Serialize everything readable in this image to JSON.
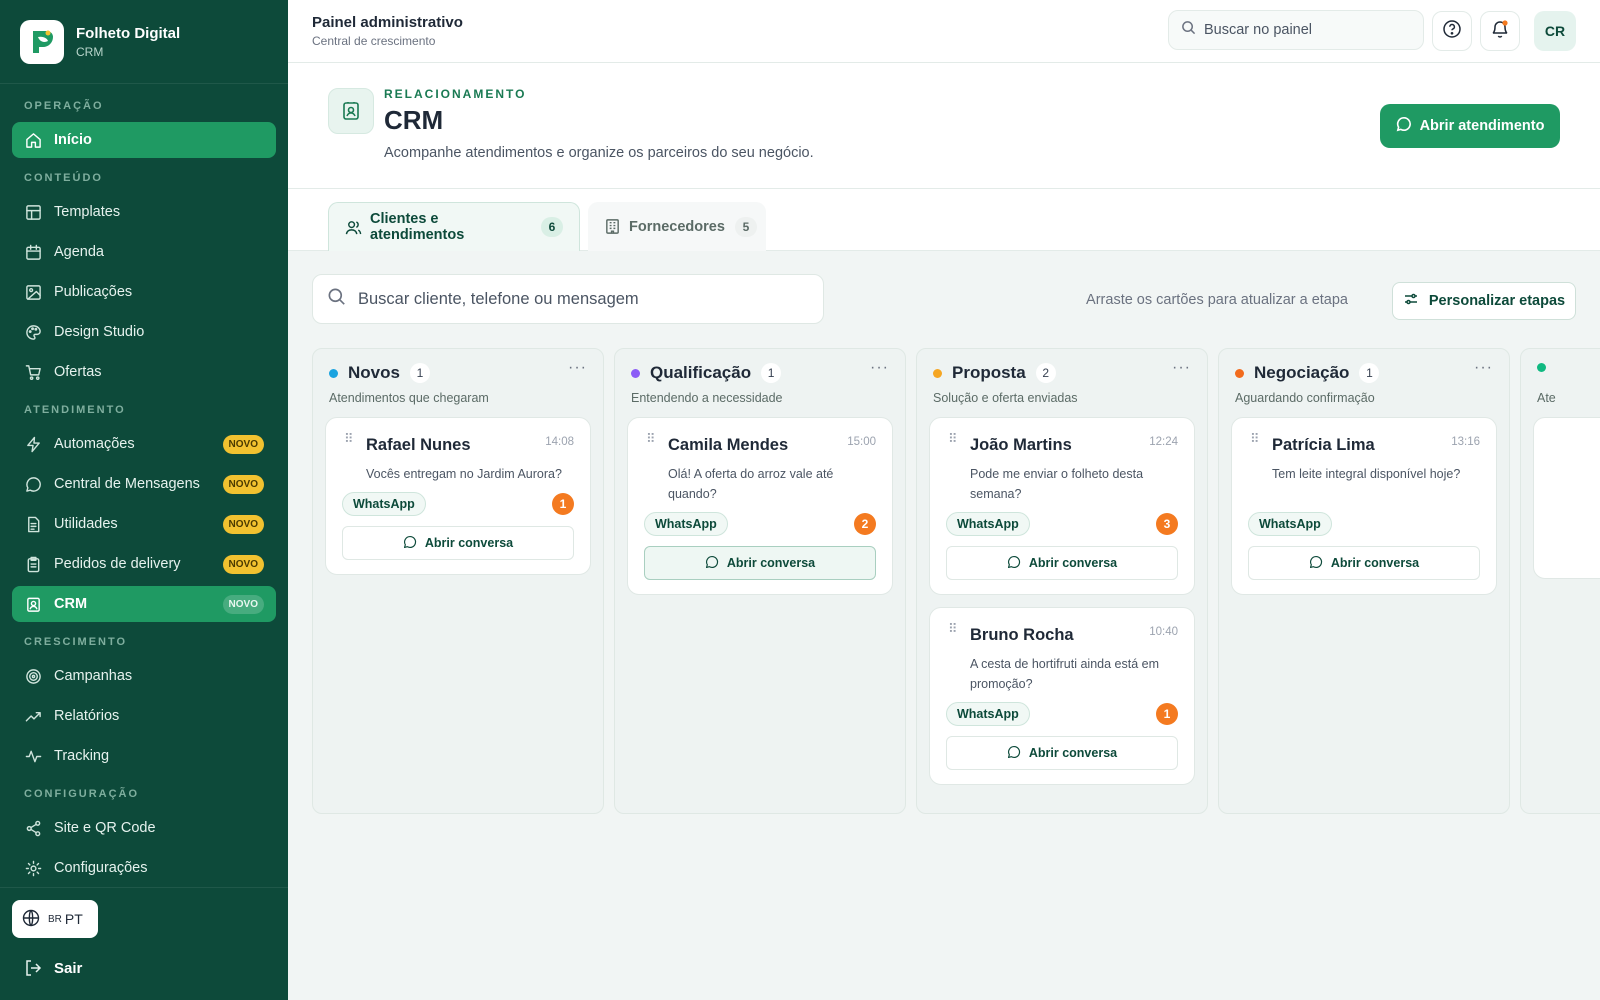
{
  "brand": {
    "title": "Folheto Digital",
    "subtitle": "CRM",
    "logo_icon": "leaf-logo-icon"
  },
  "sidebar": {
    "sections": [
      {
        "label": "OPERAÇÃO",
        "items": [
          {
            "label": "Início",
            "icon": "home-icon",
            "active": true
          }
        ]
      },
      {
        "label": "CONTEÚDO",
        "items": [
          {
            "label": "Templates",
            "icon": "layout-icon"
          },
          {
            "label": "Agenda",
            "icon": "calendar-icon"
          },
          {
            "label": "Publicações",
            "icon": "image-icon"
          },
          {
            "label": "Design Studio",
            "icon": "palette-icon"
          },
          {
            "label": "Ofertas",
            "icon": "cart-icon"
          }
        ]
      },
      {
        "label": "ATENDIMENTO",
        "items": [
          {
            "label": "Automações",
            "icon": "zap-icon",
            "badge": "NOVO"
          },
          {
            "label": "Central de Mensagens",
            "icon": "message-icon",
            "badge": "NOVO"
          },
          {
            "label": "Utilidades",
            "icon": "file-icon",
            "badge": "NOVO"
          },
          {
            "label": "Pedidos de delivery",
            "icon": "clipboard-icon",
            "badge": "NOVO"
          },
          {
            "label": "CRM",
            "icon": "contact-icon",
            "badge": "NOVO",
            "active": true
          }
        ]
      },
      {
        "label": "CRESCIMENTO",
        "items": [
          {
            "label": "Campanhas",
            "icon": "target-icon"
          },
          {
            "label": "Relatórios",
            "icon": "trend-icon"
          },
          {
            "label": "Tracking",
            "icon": "activity-icon"
          }
        ]
      },
      {
        "label": "CONFIGURAÇÃO",
        "items": [
          {
            "label": "Site e QR Code",
            "icon": "share-icon"
          },
          {
            "label": "Configurações",
            "icon": "gear-icon"
          }
        ]
      }
    ],
    "language": {
      "flag": "BR",
      "code": "PT"
    },
    "logout_label": "Sair"
  },
  "topbar": {
    "title": "Painel administrativo",
    "subtitle": "Central de crescimento",
    "search_placeholder": "Buscar no painel",
    "avatar_initials": "CR"
  },
  "header": {
    "eyebrow": "RELACIONAMENTO",
    "title": "CRM",
    "description": "Acompanhe atendimentos e organize os parceiros do seu negócio.",
    "primary_action": "Abrir atendimento"
  },
  "tabs": [
    {
      "label": "Clientes e atendimentos",
      "count": "6",
      "active": true
    },
    {
      "label": "Fornecedores",
      "count": "5",
      "active": false
    }
  ],
  "toolbar": {
    "search_placeholder": "Buscar cliente, telefone ou mensagem",
    "hint": "Arraste os cartões para atualizar a etapa",
    "customize_label": "Personalizar etapas"
  },
  "colors": {
    "sidebar_bg": "#0d4a3a",
    "accent": "#1f9a63",
    "stage_novos": "#1aa3e0",
    "stage_qualificacao": "#8b5cf6",
    "stage_proposta": "#f5a623",
    "stage_negociacao": "#f26b1d",
    "stage_next": "#10b981",
    "unread_badge": "#f47a20"
  },
  "columns": [
    {
      "title": "Novos",
      "count": "1",
      "subtitle": "Atendimentos que chegaram",
      "color_key": "stage_novos",
      "cards": [
        {
          "name": "Rafael Nunes",
          "time": "14:08",
          "message": "Vocês entregam no Jardim Aurora?",
          "channel": "WhatsApp",
          "unread": "1",
          "action": "Abrir conversa"
        }
      ]
    },
    {
      "title": "Qualificação",
      "count": "1",
      "subtitle": "Entendendo a necessidade",
      "color_key": "stage_qualificacao",
      "cards": [
        {
          "name": "Camila Mendes",
          "time": "15:00",
          "message": "Olá! A oferta do arroz vale até quando?",
          "channel": "WhatsApp",
          "unread": "2",
          "action": "Abrir conversa",
          "highlight": true
        }
      ]
    },
    {
      "title": "Proposta",
      "count": "2",
      "subtitle": "Solução e oferta enviadas",
      "color_key": "stage_proposta",
      "cards": [
        {
          "name": "João Martins",
          "time": "12:24",
          "message": "Pode me enviar o folheto desta semana?",
          "channel": "WhatsApp",
          "unread": "3",
          "action": "Abrir conversa"
        },
        {
          "name": "Bruno Rocha",
          "time": "10:40",
          "message": "A cesta de hortifruti ainda está em promoção?",
          "channel": "WhatsApp",
          "unread": "1",
          "action": "Abrir conversa"
        }
      ]
    },
    {
      "title": "Negociação",
      "count": "1",
      "subtitle": "Aguardando confirmação",
      "color_key": "stage_negociacao",
      "cards": [
        {
          "name": "Patrícia Lima",
          "time": "13:16",
          "message": "Tem leite integral disponível hoje?",
          "channel": "WhatsApp",
          "unread": "",
          "action": "Abrir conversa"
        }
      ]
    },
    {
      "title": "",
      "count": "",
      "subtitle": "Ate",
      "color_key": "stage_next",
      "cards": []
    }
  ]
}
